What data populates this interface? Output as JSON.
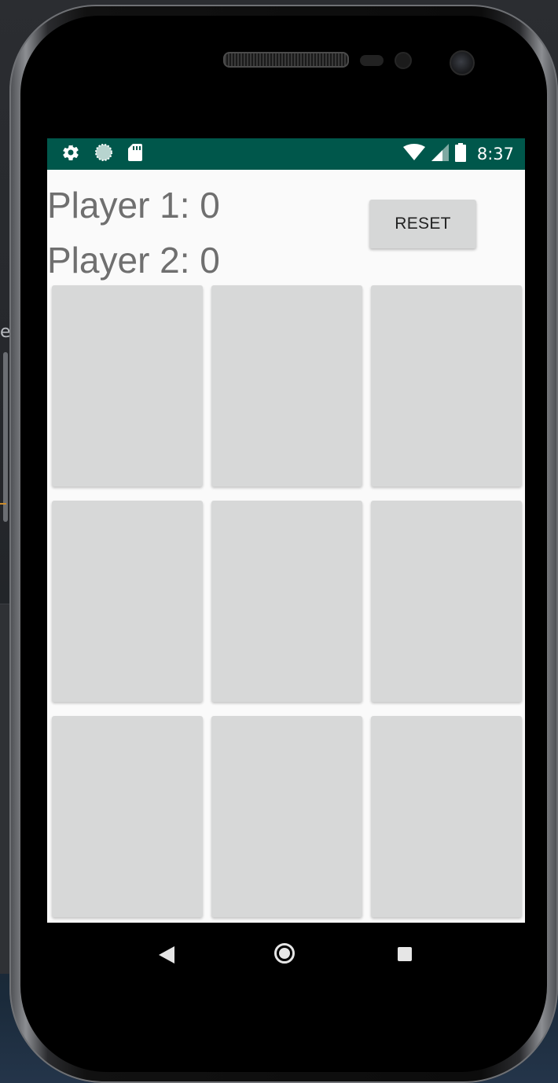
{
  "status_bar": {
    "time": "8:37",
    "left_icons": [
      "settings-icon",
      "sync-icon",
      "sd-card-icon"
    ],
    "right_icons": [
      "wifi-icon",
      "cell-signal-icon",
      "battery-icon"
    ]
  },
  "scoreboard": {
    "player1": "Player 1: 0",
    "player2": "Player 2: 0"
  },
  "reset_button": {
    "label": "RESET"
  },
  "board": {
    "cells": [
      "",
      "",
      "",
      "",
      "",
      "",
      "",
      "",
      ""
    ]
  },
  "navigation": {
    "items": [
      "back-icon",
      "home-icon",
      "recents-icon"
    ]
  },
  "colors": {
    "status_bar": "#00574b",
    "cell": "#d7d8d8",
    "button": "#d6d7d7",
    "score_text": "#6f6f6f"
  }
}
